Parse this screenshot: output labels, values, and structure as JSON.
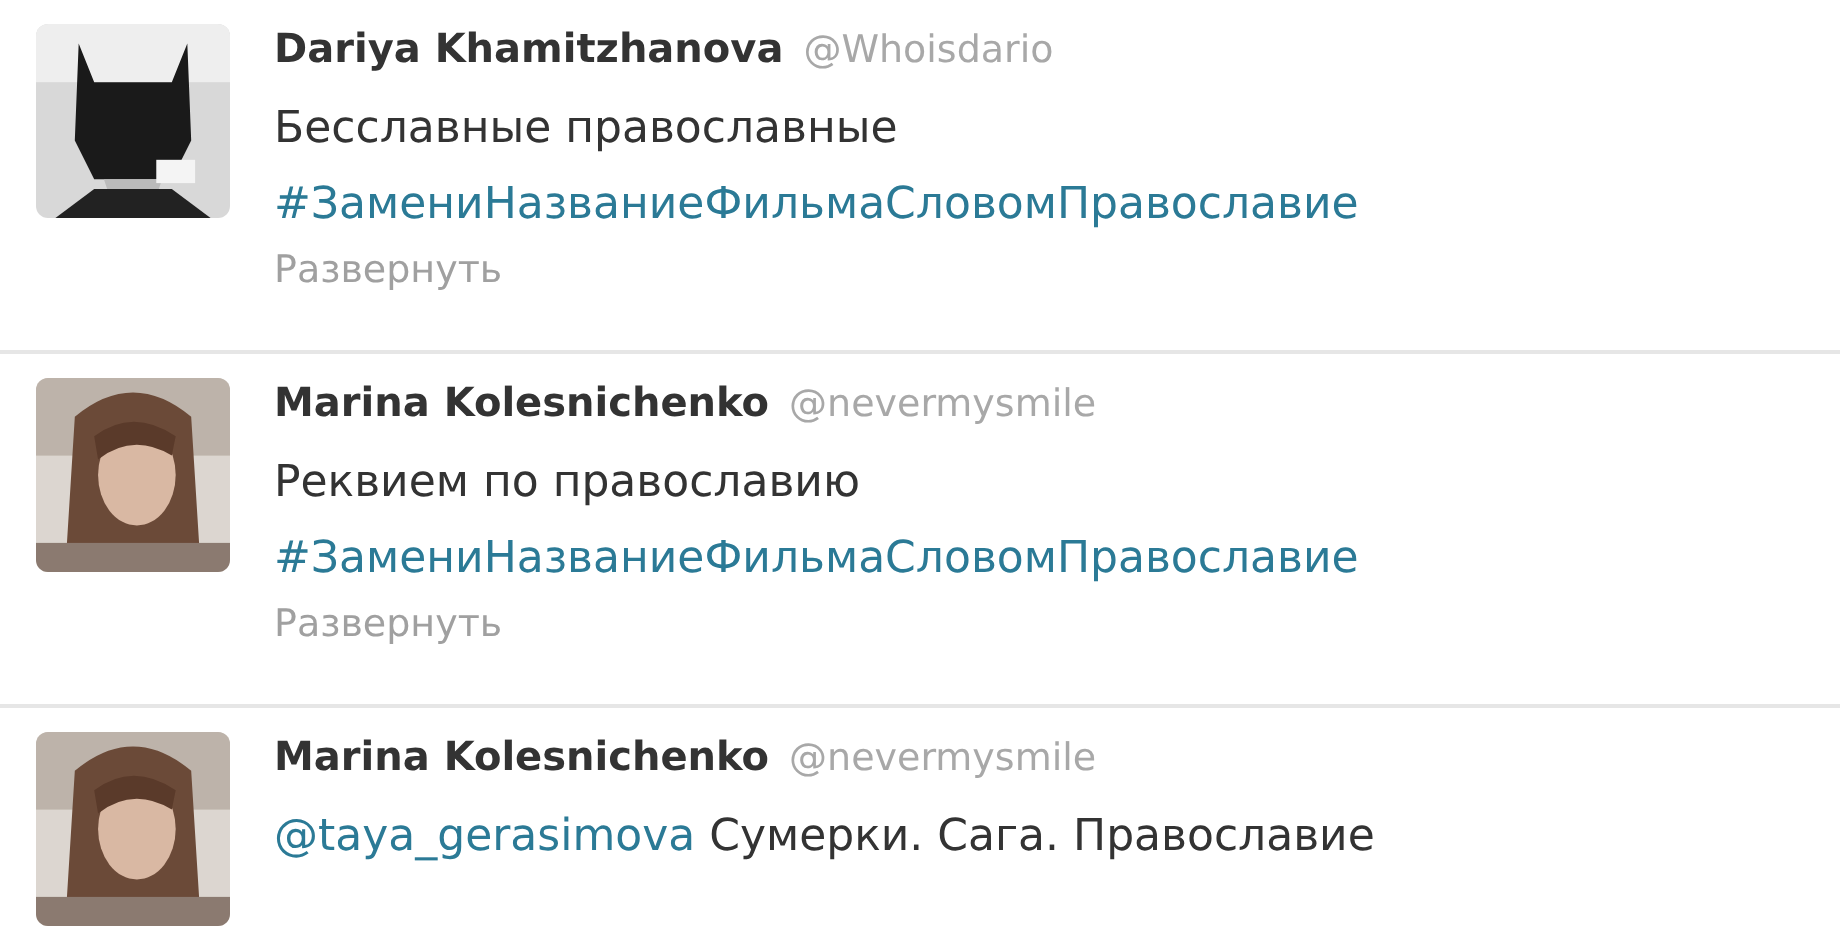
{
  "tweets": [
    {
      "name": "Dariya Khamitzhanova",
      "handle": "@Whoisdario",
      "avatar": {
        "kind": "picture"
      },
      "body": [
        {
          "kind": "text",
          "text": "Бесславные православные"
        },
        {
          "kind": "hashtag",
          "text": "#ЗамениНазваниеФильмаСловомПравославие"
        }
      ],
      "expand": "Развернуть"
    },
    {
      "name": "Marina Kolesnichenko",
      "handle": "@nevermysmile",
      "avatar": {
        "kind": "picture"
      },
      "body": [
        {
          "kind": "text",
          "text": "Реквием по православию"
        },
        {
          "kind": "hashtag",
          "text": "#ЗамениНазваниеФильмаСловомПравославие"
        }
      ],
      "expand": "Развернуть"
    },
    {
      "name": "Marina Kolesnichenko",
      "handle": "@nevermysmile",
      "avatar": {
        "kind": "picture"
      },
      "body": [
        {
          "kind": "mention",
          "text": "@taya_gerasimova"
        },
        {
          "kind": "text",
          "text": "Сумерки. Сага. Православие"
        }
      ]
    }
  ]
}
